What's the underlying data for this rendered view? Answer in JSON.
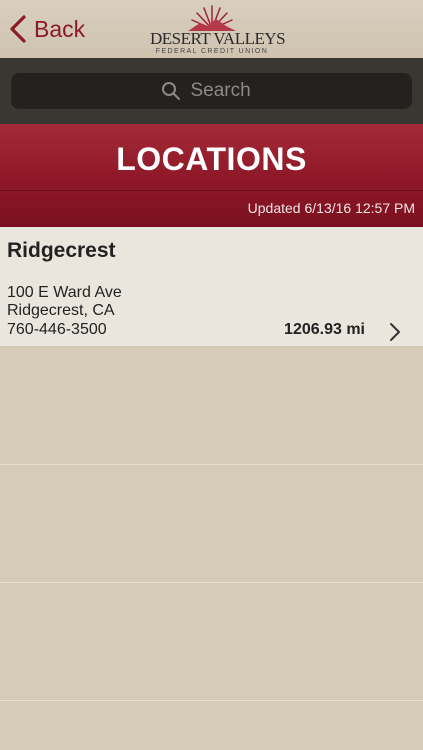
{
  "nav": {
    "back_label": "Back",
    "logo_main": "DESERT VALLEYS",
    "logo_sub": "FEDERAL CREDIT UNION"
  },
  "search": {
    "placeholder": "Search"
  },
  "header": {
    "title": "LOCATIONS",
    "updated": "Updated 6/13/16 12:57 PM"
  },
  "locations": [
    {
      "name": "Ridgecrest",
      "address1": "100 E Ward Ave",
      "address2": "Ridgecrest, CA",
      "phone": "760-446-3500",
      "distance": "1206.93 mi"
    }
  ],
  "colors": {
    "accent": "#8a1a24",
    "band": "#8c1626",
    "search_bg": "#3a3632"
  }
}
